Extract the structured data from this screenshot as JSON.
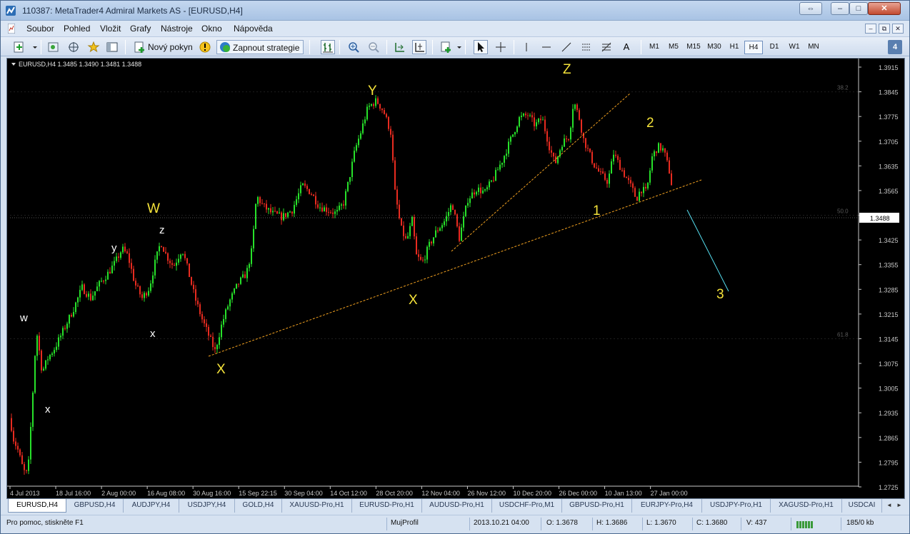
{
  "window": {
    "title": "110387: MetaTrader4 Admiral Markets AS - [EURUSD,H4]",
    "controls": {
      "minimize": "–",
      "maximize": "□",
      "close": "✕",
      "extra": "⇔"
    }
  },
  "menu": {
    "items": [
      "Soubor",
      "Pohled",
      "Vložit",
      "Grafy",
      "Nástroje",
      "Okno",
      "Nápověda"
    ],
    "mdi": [
      "–",
      "⧉",
      "✕"
    ]
  },
  "toolbar": {
    "new_order_label": "Nový pokyn",
    "strategy_label": "Zapnout strategie",
    "timeframes": [
      "M1",
      "M5",
      "M15",
      "M30",
      "H1",
      "H4",
      "D1",
      "W1",
      "MN"
    ],
    "active_timeframe": "H4",
    "text_tool": "A",
    "badge": "4"
  },
  "chart_data": {
    "type": "candlestick",
    "symbol_header": "EURUSD,H4  1.3485 1.3490 1.3481 1.3488",
    "current_price": "1.3488",
    "ylim": [
      1.2725,
      1.3915
    ],
    "price_ticks": [
      "1.3915",
      "1.3845",
      "1.3775",
      "1.3705",
      "1.3635",
      "1.3565",
      "1.3495",
      "1.3425",
      "1.3355",
      "1.3285",
      "1.3215",
      "1.3145",
      "1.3075",
      "1.3005",
      "1.2935",
      "1.2865",
      "1.2795",
      "1.2725"
    ],
    "fib_labels": {
      "38.2": "38.2",
      "50.0": "50.0",
      "61.8": "61.8"
    },
    "time_ticks": [
      "4 Jul 2013",
      "18 Jul 16:00",
      "2 Aug 00:00",
      "16 Aug 08:00",
      "30 Aug 16:00",
      "15 Sep 22:15",
      "30 Sep 04:00",
      "14 Oct 12:00",
      "28 Oct 20:00",
      "12 Nov 04:00",
      "26 Nov 12:00",
      "10 Dec 20:00",
      "26 Dec 00:00",
      "10 Jan 13:00",
      "27 Jan 00:00"
    ],
    "price_path": [
      [
        0,
        1.302
      ],
      [
        6,
        1.287
      ],
      [
        14,
        1.283
      ],
      [
        22,
        1.277
      ],
      [
        28,
        1.276
      ],
      [
        34,
        1.296
      ],
      [
        40,
        1.317
      ],
      [
        48,
        1.305
      ],
      [
        56,
        1.309
      ],
      [
        66,
        1.312
      ],
      [
        78,
        1.317
      ],
      [
        92,
        1.323
      ],
      [
        104,
        1.329
      ],
      [
        116,
        1.326
      ],
      [
        128,
        1.33
      ],
      [
        140,
        1.333
      ],
      [
        150,
        1.336
      ],
      [
        160,
        1.34
      ],
      [
        168,
        1.338
      ],
      [
        178,
        1.33
      ],
      [
        188,
        1.326
      ],
      [
        198,
        1.329
      ],
      [
        206,
        1.336
      ],
      [
        214,
        1.342
      ],
      [
        222,
        1.338
      ],
      [
        232,
        1.335
      ],
      [
        244,
        1.34
      ],
      [
        252,
        1.334
      ],
      [
        262,
        1.326
      ],
      [
        272,
        1.32
      ],
      [
        282,
        1.315
      ],
      [
        290,
        1.311
      ],
      [
        300,
        1.319
      ],
      [
        310,
        1.325
      ],
      [
        322,
        1.33
      ],
      [
        334,
        1.333
      ],
      [
        342,
        1.34
      ],
      [
        348,
        1.355
      ],
      [
        358,
        1.352
      ],
      [
        370,
        1.35
      ],
      [
        384,
        1.349
      ],
      [
        398,
        1.351
      ],
      [
        412,
        1.358
      ],
      [
        424,
        1.356
      ],
      [
        436,
        1.352
      ],
      [
        448,
        1.351
      ],
      [
        460,
        1.35
      ],
      [
        470,
        1.353
      ],
      [
        478,
        1.36
      ],
      [
        486,
        1.368
      ],
      [
        494,
        1.373
      ],
      [
        504,
        1.38
      ],
      [
        516,
        1.382
      ],
      [
        526,
        1.379
      ],
      [
        536,
        1.373
      ],
      [
        542,
        1.356
      ],
      [
        550,
        1.346
      ],
      [
        558,
        1.342
      ],
      [
        566,
        1.348
      ],
      [
        572,
        1.338
      ],
      [
        580,
        1.336
      ],
      [
        590,
        1.341
      ],
      [
        600,
        1.345
      ],
      [
        612,
        1.348
      ],
      [
        622,
        1.353
      ],
      [
        632,
        1.343
      ],
      [
        644,
        1.354
      ],
      [
        656,
        1.357
      ],
      [
        668,
        1.356
      ],
      [
        680,
        1.36
      ],
      [
        692,
        1.365
      ],
      [
        704,
        1.371
      ],
      [
        716,
        1.377
      ],
      [
        728,
        1.378
      ],
      [
        738,
        1.375
      ],
      [
        748,
        1.377
      ],
      [
        758,
        1.369
      ],
      [
        766,
        1.364
      ],
      [
        776,
        1.37
      ],
      [
        786,
        1.372
      ],
      [
        792,
        1.382
      ],
      [
        800,
        1.377
      ],
      [
        806,
        1.371
      ],
      [
        812,
        1.368
      ],
      [
        820,
        1.364
      ],
      [
        830,
        1.361
      ],
      [
        840,
        1.359
      ],
      [
        848,
        1.367
      ],
      [
        858,
        1.363
      ],
      [
        866,
        1.36
      ],
      [
        874,
        1.357
      ],
      [
        880,
        1.354
      ],
      [
        886,
        1.357
      ],
      [
        894,
        1.356
      ],
      [
        902,
        1.366
      ],
      [
        910,
        1.369
      ],
      [
        918,
        1.368
      ],
      [
        926,
        1.362
      ],
      [
        932,
        1.355
      ],
      [
        936,
        1.353
      ],
      [
        940,
        1.3488
      ]
    ],
    "annotations": [
      {
        "text": "w",
        "color": "#ffffff"
      },
      {
        "text": "x",
        "color": "#ffffff"
      },
      {
        "text": "y",
        "color": "#ffffff"
      },
      {
        "text": "x",
        "color": "#ffffff"
      },
      {
        "text": "z",
        "color": "#ffffff"
      },
      {
        "text": "W",
        "color": "#f5e33a"
      },
      {
        "text": "X",
        "color": "#f5e33a"
      },
      {
        "text": "Y",
        "color": "#f5e33a"
      },
      {
        "text": "X",
        "color": "#f5e33a"
      },
      {
        "text": "Z",
        "color": "#f5e33a"
      },
      {
        "text": "1",
        "color": "#f5e33a"
      },
      {
        "text": "2",
        "color": "#f5e33a"
      },
      {
        "text": "3",
        "color": "#f5e33a"
      }
    ],
    "colors": {
      "bull": "#27e12a",
      "bear": "#e82b20",
      "trend": "#f0a020",
      "projection": "#55ddee",
      "grid": "#3a3a3a",
      "axis_text": "#c8c8c8"
    }
  },
  "tabs": {
    "items": [
      "EURUSD,H4",
      "GBPUSD,H4",
      "AUDJPY,H4",
      "USDJPY,H4",
      "GOLD,H4",
      "XAUUSD-Pro,H1",
      "EURUSD-Pro,H1",
      "AUDUSD-Pro,H1",
      "USDCHF-Pro,M1",
      "GBPUSD-Pro,H1",
      "EURJPY-Pro,H4",
      "USDJPY-Pro,H1",
      "XAGUSD-Pro,H1",
      "USDCAI"
    ],
    "active": "EURUSD,H4",
    "nav_left": "◄",
    "nav_right": "►"
  },
  "status": {
    "help": "Pro pomoc, stiskněte F1",
    "profile": "MujProfil",
    "datetime": "2013.10.21 04:00",
    "open": "O: 1.3678",
    "high": "H: 1.3686",
    "low": "L: 1.3670",
    "close": "C: 1.3680",
    "volume": "V: 437",
    "traffic": "185/0 kb"
  }
}
